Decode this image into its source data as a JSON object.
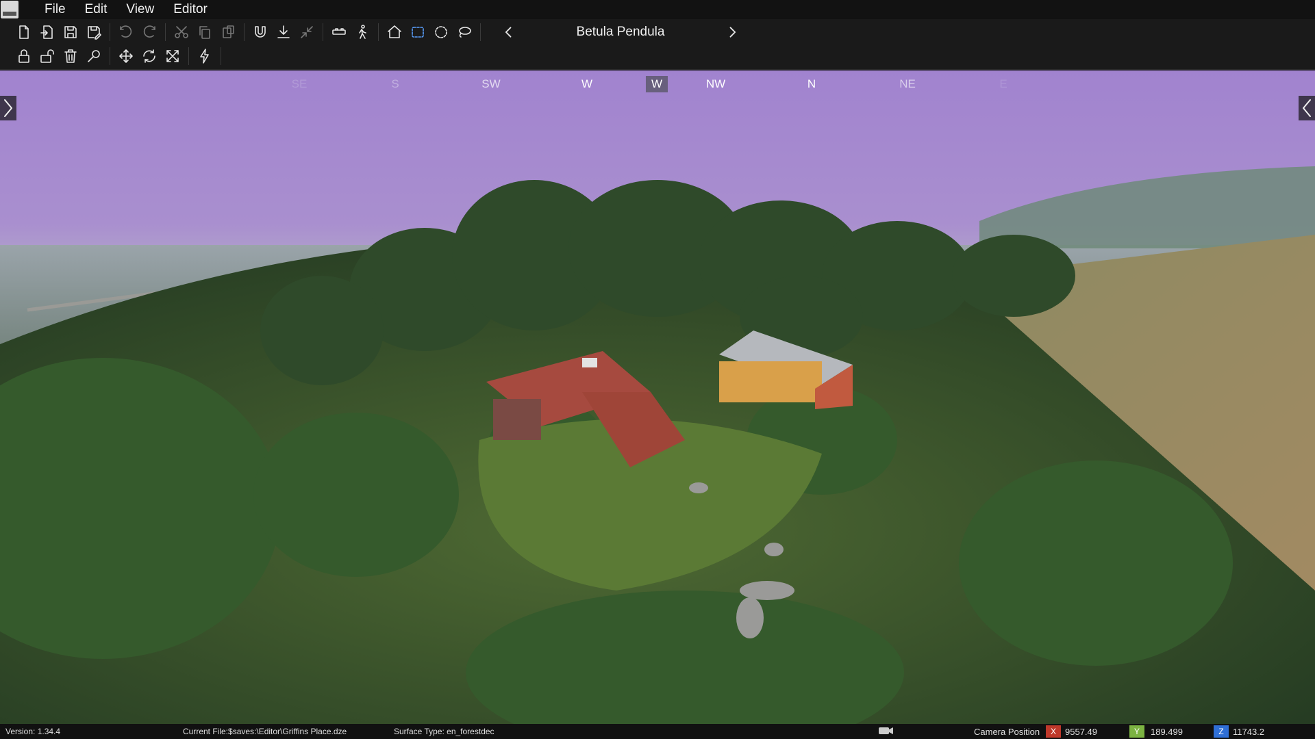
{
  "menu": {
    "items": [
      {
        "label": "File"
      },
      {
        "label": "Edit"
      },
      {
        "label": "View"
      },
      {
        "label": "Editor"
      }
    ]
  },
  "toolbar": {
    "row1": [
      "new-file-icon",
      "open-file-icon",
      "save-icon",
      "save-as-icon",
      "undo-icon",
      "redo-icon",
      "cut-icon",
      "copy-icon",
      "paste-icon",
      "magnet-snap-icon",
      "ground-drop-icon",
      "collapse-icon",
      "binoculars-icon",
      "walk-mode-icon",
      "home-icon",
      "box-select-icon",
      "circle-select-icon",
      "lasso-select-icon"
    ],
    "row2": [
      "lock-icon",
      "unlock-icon",
      "trash-icon",
      "search-icon",
      "move-icon",
      "rotate-icon",
      "scale-icon",
      "lightning-icon"
    ]
  },
  "object_browser": {
    "current_object": "Betula Pendula"
  },
  "compass": {
    "marks": [
      {
        "label": "SE",
        "faded": true
      },
      {
        "label": "S",
        "faded": true
      },
      {
        "label": "SW",
        "faded": false
      },
      {
        "label": "W",
        "faded": false
      },
      {
        "label": "W",
        "faded": false,
        "current": true
      },
      {
        "label": "NW",
        "faded": false
      },
      {
        "label": "N",
        "faded": false
      },
      {
        "label": "NE",
        "faded": false
      },
      {
        "label": "E",
        "faded": true
      }
    ]
  },
  "status": {
    "version": "Version:  1.34.4",
    "current_file": "Current File:$saves:\\Editor\\Griffins Place.dze",
    "surface_type": "Surface Type: en_forestdec",
    "camera_label": "Camera Position",
    "x_label": "X",
    "y_label": "Y",
    "z_label": "Z",
    "camera_x": "9557.49",
    "camera_y": "189.499",
    "camera_z": "11743.2"
  },
  "colors": {
    "sky": "#a58ad0",
    "axis_x": "#c0392b",
    "axis_y": "#7cb342",
    "axis_z": "#2f6fd6",
    "selection_accent": "#5aa0ff"
  }
}
